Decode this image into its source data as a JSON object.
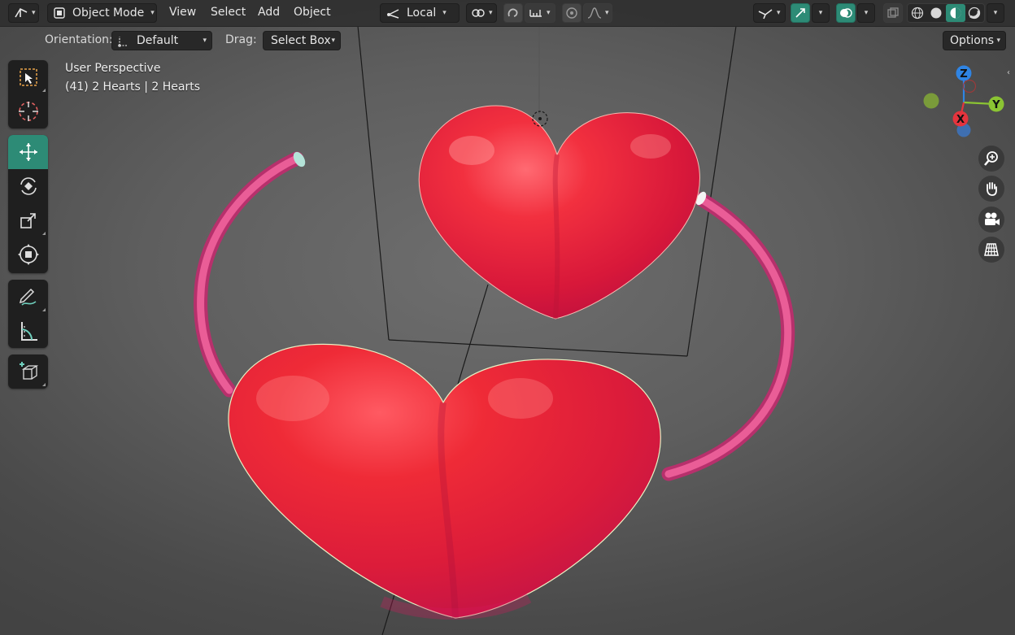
{
  "header": {
    "mode_label": "Object Mode",
    "menus": [
      "View",
      "Select",
      "Add",
      "Object"
    ],
    "transform_pivot_label": "Local",
    "options_label": "Options"
  },
  "toolbar_settings": {
    "orientation_label": "Orientation:",
    "orientation_value": "Default",
    "drag_label": "Drag:",
    "drag_value": "Select Box"
  },
  "viewport": {
    "view_name": "User Perspective",
    "object_info": "(41) 2 Hearts | 2 Hearts"
  },
  "gizmo": {
    "axes": [
      "Z",
      "Y",
      "X"
    ],
    "colors": {
      "x": "#e5343d",
      "y": "#8bc433",
      "z": "#2f84e3"
    }
  },
  "tools": [
    {
      "name": "select-box-icon",
      "active": false
    },
    {
      "name": "cursor-icon",
      "active": false
    },
    {
      "name": "move-icon",
      "active": true
    },
    {
      "name": "rotate-icon",
      "active": false
    },
    {
      "name": "scale-icon",
      "active": false
    },
    {
      "name": "transform-icon",
      "active": false
    },
    {
      "name": "annotate-icon",
      "active": false
    },
    {
      "name": "measure-icon",
      "active": false
    },
    {
      "name": "add-cube-icon",
      "active": false
    }
  ],
  "nav_icons": [
    "zoom-icon",
    "pan-hand-icon",
    "camera-icon",
    "grid-icon"
  ],
  "colors": {
    "accent": "#2d8b76",
    "heart": "#e52236",
    "tube": "#e0508e"
  }
}
